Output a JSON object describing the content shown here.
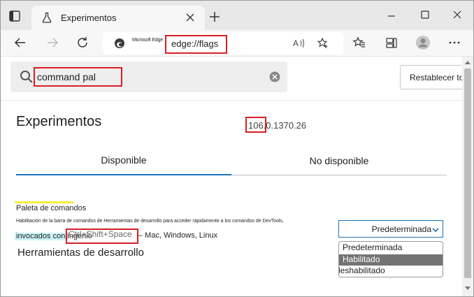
{
  "browser": {
    "tab": {
      "title": "Experimentos",
      "close_icon": "close-icon",
      "favicon": "flask-icon"
    },
    "address_bar": {
      "site_name": "Microsoft Edge",
      "url": "edge://flags"
    }
  },
  "page": {
    "search": {
      "query": "command pal",
      "placeholder": ""
    },
    "reset_button": "Restablecer todo",
    "title": "Experimentos",
    "version": "106.0.1370.26",
    "tabs": [
      {
        "label": "Disponible",
        "active": true
      },
      {
        "label": "No disponible",
        "active": false
      }
    ],
    "flag": {
      "title": "Paleta de comandos",
      "description": "Habilitación de la barra de comandos de Herramientas de desarrollo para acceder rápidamente a los comandos de DevTools,",
      "description_cont": "invocados con ingenio",
      "shortcut": "Ctrl+Shift+Space",
      "platforms": "– Mac, Windows, Linux",
      "section_heading": "Herramientas de desarrollo",
      "select": {
        "value": "Predeterminada",
        "options": [
          "Predeterminada",
          "Habilitado",
          "deshabilitado"
        ],
        "highlighted": "Habilitado"
      }
    }
  },
  "colors": {
    "accent": "#1a73b8",
    "annotation": "#d81f26",
    "highlight_yellow": "#ffeb3b",
    "highlight_cyan": "#cdf3f6"
  }
}
